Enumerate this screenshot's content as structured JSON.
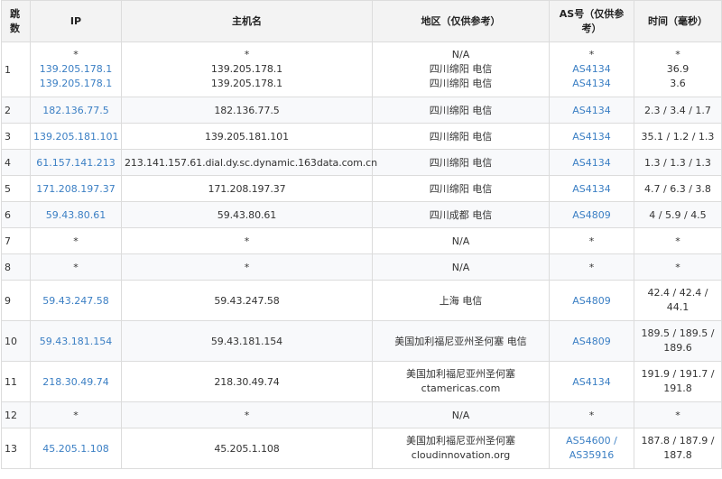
{
  "headers": {
    "hop": "跳数",
    "ip": "IP",
    "host": "主机名",
    "region": "地区（仅供参考）",
    "as": "AS号（仅供参考）",
    "time": "时间（毫秒）"
  },
  "rows": [
    {
      "hop": "1",
      "ip": [
        "*",
        "139.205.178.1",
        "139.205.178.1"
      ],
      "host": [
        "*",
        "139.205.178.1",
        "139.205.178.1"
      ],
      "region": [
        "N/A",
        "四川绵阳 电信",
        "四川绵阳 电信"
      ],
      "as": [
        "*",
        "AS4134",
        "AS4134"
      ],
      "time": [
        "*",
        "36.9",
        "3.6"
      ]
    },
    {
      "hop": "2",
      "ip": [
        "182.136.77.5"
      ],
      "host": [
        "182.136.77.5"
      ],
      "region": [
        "四川绵阳 电信"
      ],
      "as": [
        "AS4134"
      ],
      "time": [
        "2.3 / 3.4 / 1.7"
      ]
    },
    {
      "hop": "3",
      "ip": [
        "139.205.181.101"
      ],
      "host": [
        "139.205.181.101"
      ],
      "region": [
        "四川绵阳 电信"
      ],
      "as": [
        "AS4134"
      ],
      "time": [
        "35.1 / 1.2 / 1.3"
      ]
    },
    {
      "hop": "4",
      "ip": [
        "61.157.141.213"
      ],
      "host": [
        "213.141.157.61.dial.dy.sc.dynamic.163data.com.cn"
      ],
      "region": [
        "四川绵阳 电信"
      ],
      "as": [
        "AS4134"
      ],
      "time": [
        "1.3 / 1.3 / 1.3"
      ]
    },
    {
      "hop": "5",
      "ip": [
        "171.208.197.37"
      ],
      "host": [
        "171.208.197.37"
      ],
      "region": [
        "四川绵阳 电信"
      ],
      "as": [
        "AS4134"
      ],
      "time": [
        "4.7 / 6.3 / 3.8"
      ]
    },
    {
      "hop": "6",
      "ip": [
        "59.43.80.61"
      ],
      "host": [
        "59.43.80.61"
      ],
      "region": [
        "四川成都 电信"
      ],
      "as": [
        "AS4809"
      ],
      "time": [
        "4 / 5.9 / 4.5"
      ]
    },
    {
      "hop": "7",
      "ip": [
        "*"
      ],
      "host": [
        "*"
      ],
      "region": [
        "N/A"
      ],
      "as": [
        "*"
      ],
      "time": [
        "*"
      ]
    },
    {
      "hop": "8",
      "ip": [
        "*"
      ],
      "host": [
        "*"
      ],
      "region": [
        "N/A"
      ],
      "as": [
        "*"
      ],
      "time": [
        "*"
      ]
    },
    {
      "hop": "9",
      "ip": [
        "59.43.247.58"
      ],
      "host": [
        "59.43.247.58"
      ],
      "region": [
        "上海 电信"
      ],
      "as": [
        "AS4809"
      ],
      "time": [
        "42.4 / 42.4 /",
        "44.1"
      ]
    },
    {
      "hop": "10",
      "ip": [
        "59.43.181.154"
      ],
      "host": [
        "59.43.181.154"
      ],
      "region": [
        "美国加利福尼亚州圣何塞 电信"
      ],
      "as": [
        "AS4809"
      ],
      "time": [
        "189.5 / 189.5 /",
        "189.6"
      ]
    },
    {
      "hop": "11",
      "ip": [
        "218.30.49.74"
      ],
      "host": [
        "218.30.49.74"
      ],
      "region": [
        "美国加利福尼亚州圣何塞",
        "ctamericas.com"
      ],
      "as": [
        "AS4134"
      ],
      "time": [
        "191.9 / 191.7 /",
        "191.8"
      ]
    },
    {
      "hop": "12",
      "ip": [
        "*"
      ],
      "host": [
        "*"
      ],
      "region": [
        "N/A"
      ],
      "as": [
        "*"
      ],
      "time": [
        "*"
      ]
    },
    {
      "hop": "13",
      "ip": [
        "45.205.1.108"
      ],
      "host": [
        "45.205.1.108"
      ],
      "region": [
        "美国加利福尼亚州圣何塞",
        "cloudinnovation.org"
      ],
      "as": [
        "AS54600 /",
        "AS35916"
      ],
      "time": [
        "187.8 / 187.9 /",
        "187.8"
      ]
    }
  ]
}
